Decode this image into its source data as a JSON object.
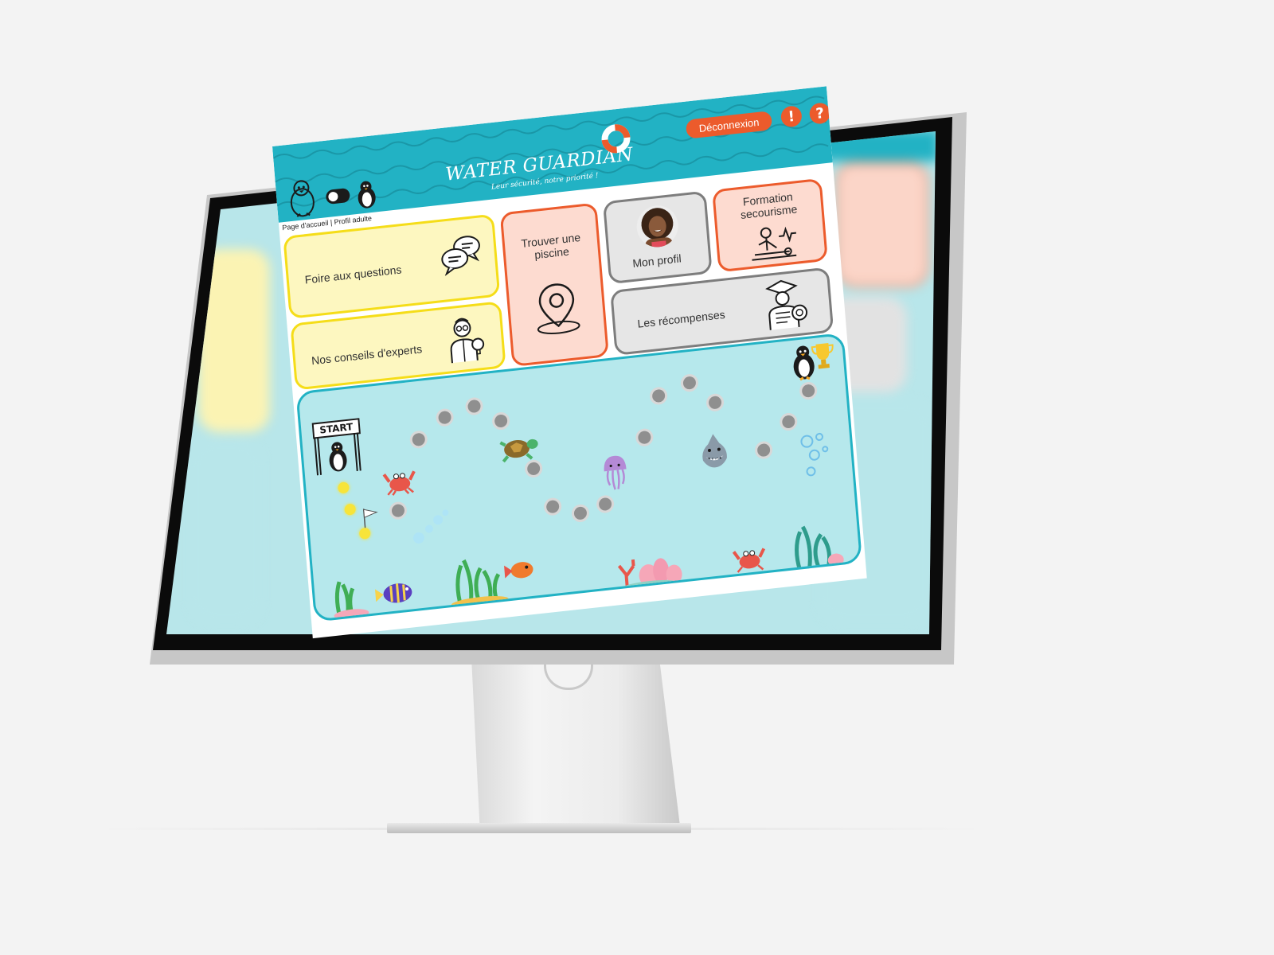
{
  "header": {
    "logo_title": "WATER GUARDIAN",
    "logo_subtitle": "Leur sécurité, notre priorité !",
    "logout_label": "Déconnexion",
    "alert_label": "!",
    "help_label": "?"
  },
  "breadcrumb": "Page d'accueil | Profil adulte",
  "cards": {
    "faq": "Foire aux questions",
    "experts": "Nos conseils d'experts",
    "pool": "Trouver une piscine",
    "profile": "Mon profil",
    "first_aid": "Formation secourisme",
    "rewards": "Les récompenses"
  },
  "game": {
    "start_label": "START"
  },
  "colors": {
    "teal": "#22b2c4",
    "orange": "#ec5b2c",
    "yellow_bg": "#fdf7c0",
    "yellow_border": "#f5dd19",
    "peach_bg": "#fddbd0",
    "grey_bg": "#e6e6e6",
    "game_bg": "#b6e8ec"
  },
  "icons": [
    "penguin-icon",
    "dark-mode-toggle",
    "lifebuoy-icon",
    "chat-bubbles-icon",
    "expert-icon",
    "location-pin-icon",
    "avatar",
    "first-aid-icon",
    "graduate-award-icon",
    "trophy-icon",
    "crab-icon",
    "turtle-icon",
    "jellyfish-icon",
    "shark-icon",
    "fish-icon",
    "seaweed-icon",
    "coral-icon",
    "bubbles-icon",
    "flag-icon"
  ]
}
